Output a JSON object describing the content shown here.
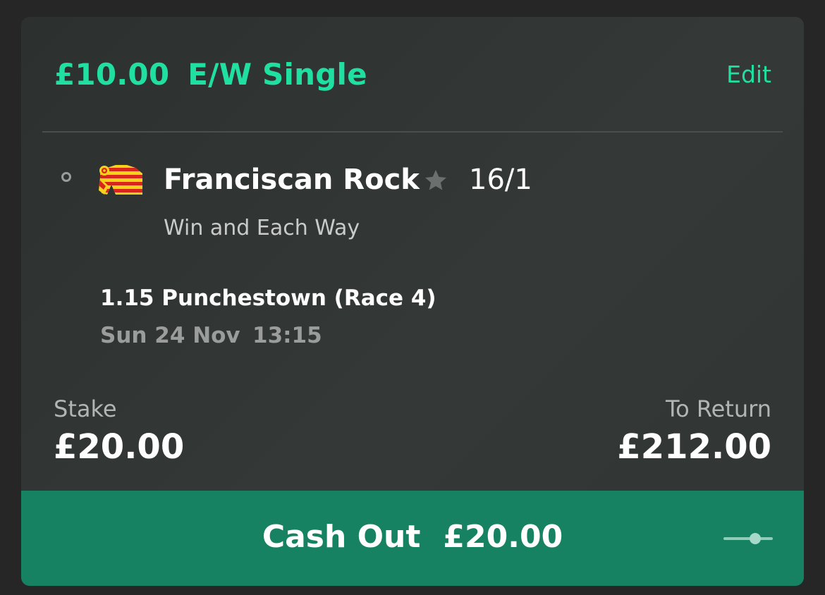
{
  "bet": {
    "stake_per_way": "£10.00",
    "type": "E/W Single",
    "edit_label": "Edit"
  },
  "selection": {
    "runner": "Franciscan Rock",
    "odds": "16/1",
    "market": "Win and Each Way",
    "favourite_icon": "star-icon",
    "silks_colors": [
      "#f5d31a",
      "#d8261d"
    ]
  },
  "event": {
    "name": "1.15 Punchestown (Race 4)",
    "date": "Sun 24 Nov",
    "time": "13:15"
  },
  "totals": {
    "stake_label": "Stake",
    "stake_value": "£20.00",
    "return_label": "To Return",
    "return_value": "£212.00"
  },
  "cashout": {
    "label": "Cash Out",
    "amount": "£20.00",
    "icon": "slider-icon"
  },
  "colors": {
    "accent": "#1fe0a0",
    "cashout_bg": "#168262",
    "card_bg": "#313533",
    "page_bg": "#262626"
  }
}
